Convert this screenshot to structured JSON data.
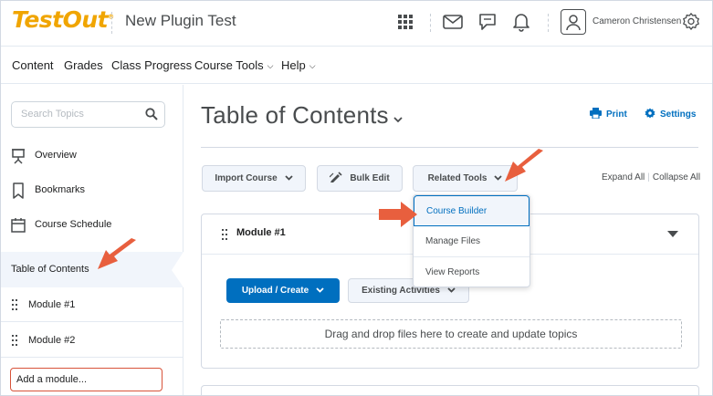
{
  "header": {
    "logo_text": "TestOut",
    "logo_mark": "®",
    "course_title": "New Plugin Test",
    "user_name": "Cameron Christensen",
    "icons": [
      "apps-grid-icon",
      "mail-icon",
      "chat-icon",
      "bell-icon",
      "user-avatar-icon",
      "gear-icon"
    ]
  },
  "nav": {
    "items": [
      "Content",
      "Grades",
      "Class Progress",
      "Course Tools",
      "Help"
    ]
  },
  "sidebar": {
    "search_placeholder": "Search Topics",
    "items": [
      {
        "label": "Overview",
        "icon": "presentation-icon"
      },
      {
        "label": "Bookmarks",
        "icon": "bookmark-icon"
      },
      {
        "label": "Course Schedule",
        "icon": "calendar-icon"
      }
    ],
    "toc_label": "Table of Contents",
    "modules": [
      "Module #1",
      "Module #2"
    ],
    "add_module_placeholder": "Add a module..."
  },
  "main": {
    "title": "Table of Contents",
    "print_label": "Print",
    "settings_label": "Settings",
    "toolbar": {
      "import_label": "Import Course",
      "bulk_edit_label": "Bulk Edit",
      "related_tools_label": "Related Tools",
      "expand_all": "Expand All",
      "collapse_all": "Collapse All"
    },
    "related_tools_menu": [
      "Course Builder",
      "Manage Files",
      "View Reports"
    ],
    "module_card": {
      "title": "Module #1",
      "upload_label": "Upload / Create",
      "existing_label": "Existing Activities",
      "dropzone_text": "Drag and drop files here to create and update topics"
    }
  },
  "colors": {
    "brand_logo": "#f0a500",
    "primary_blue": "#006fbf",
    "annotation_arrow": "#e85f3e"
  }
}
